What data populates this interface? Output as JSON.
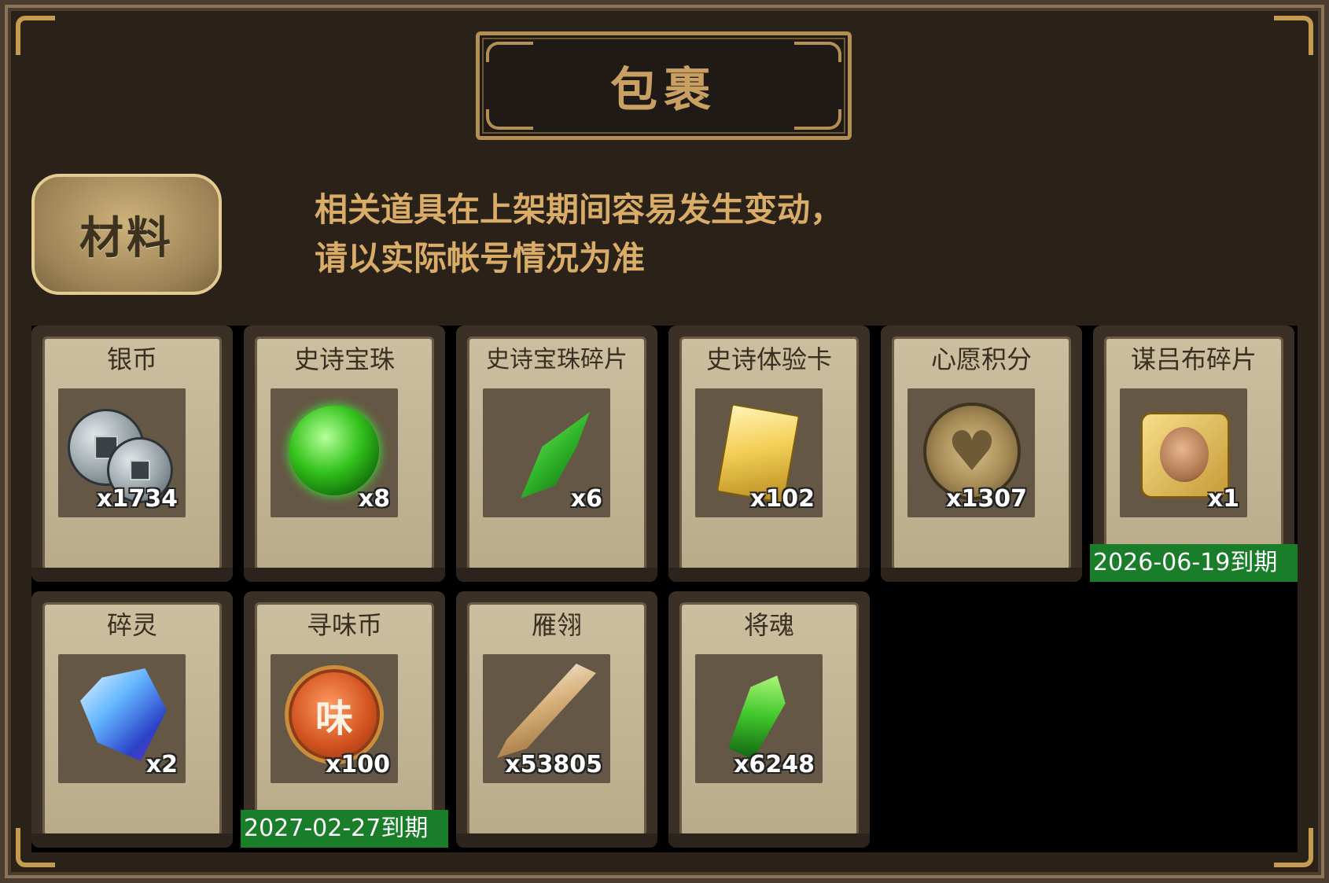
{
  "window": {
    "title": "包裹"
  },
  "tab": {
    "label": "材料"
  },
  "notice": {
    "line1": "相关道具在上架期间容易发生变动，",
    "line2": "请以实际帐号情况为准"
  },
  "items": [
    {
      "name": "银币",
      "qty": "x1734",
      "expiry": "",
      "icon": "silver-coin-icon"
    },
    {
      "name": "史诗宝珠",
      "qty": "x8",
      "expiry": "",
      "icon": "green-orb-icon"
    },
    {
      "name": "史诗宝珠碎片",
      "qty": "x6",
      "expiry": "",
      "icon": "green-shard-icon"
    },
    {
      "name": "史诗体验卡",
      "qty": "x102",
      "expiry": "",
      "icon": "gold-card-icon"
    },
    {
      "name": "心愿积分",
      "qty": "x1307",
      "expiry": "",
      "icon": "heart-coin-icon"
    },
    {
      "name": "谋吕布碎片",
      "qty": "x1",
      "expiry": "2026-06-19到期",
      "icon": "hero-puzzle-icon"
    },
    {
      "name": "碎灵",
      "qty": "x2",
      "expiry": "",
      "icon": "crystal-puzzle-icon"
    },
    {
      "name": "寻味币",
      "qty": "x100",
      "expiry": "2027-02-27到期",
      "icon": "flavor-coin-icon"
    },
    {
      "name": "雁翎",
      "qty": "x53805",
      "expiry": "",
      "icon": "feather-icon"
    },
    {
      "name": "将魂",
      "qty": "x6248",
      "expiry": "",
      "icon": "green-gem-icon"
    }
  ],
  "flavor_coin_glyph": "味"
}
